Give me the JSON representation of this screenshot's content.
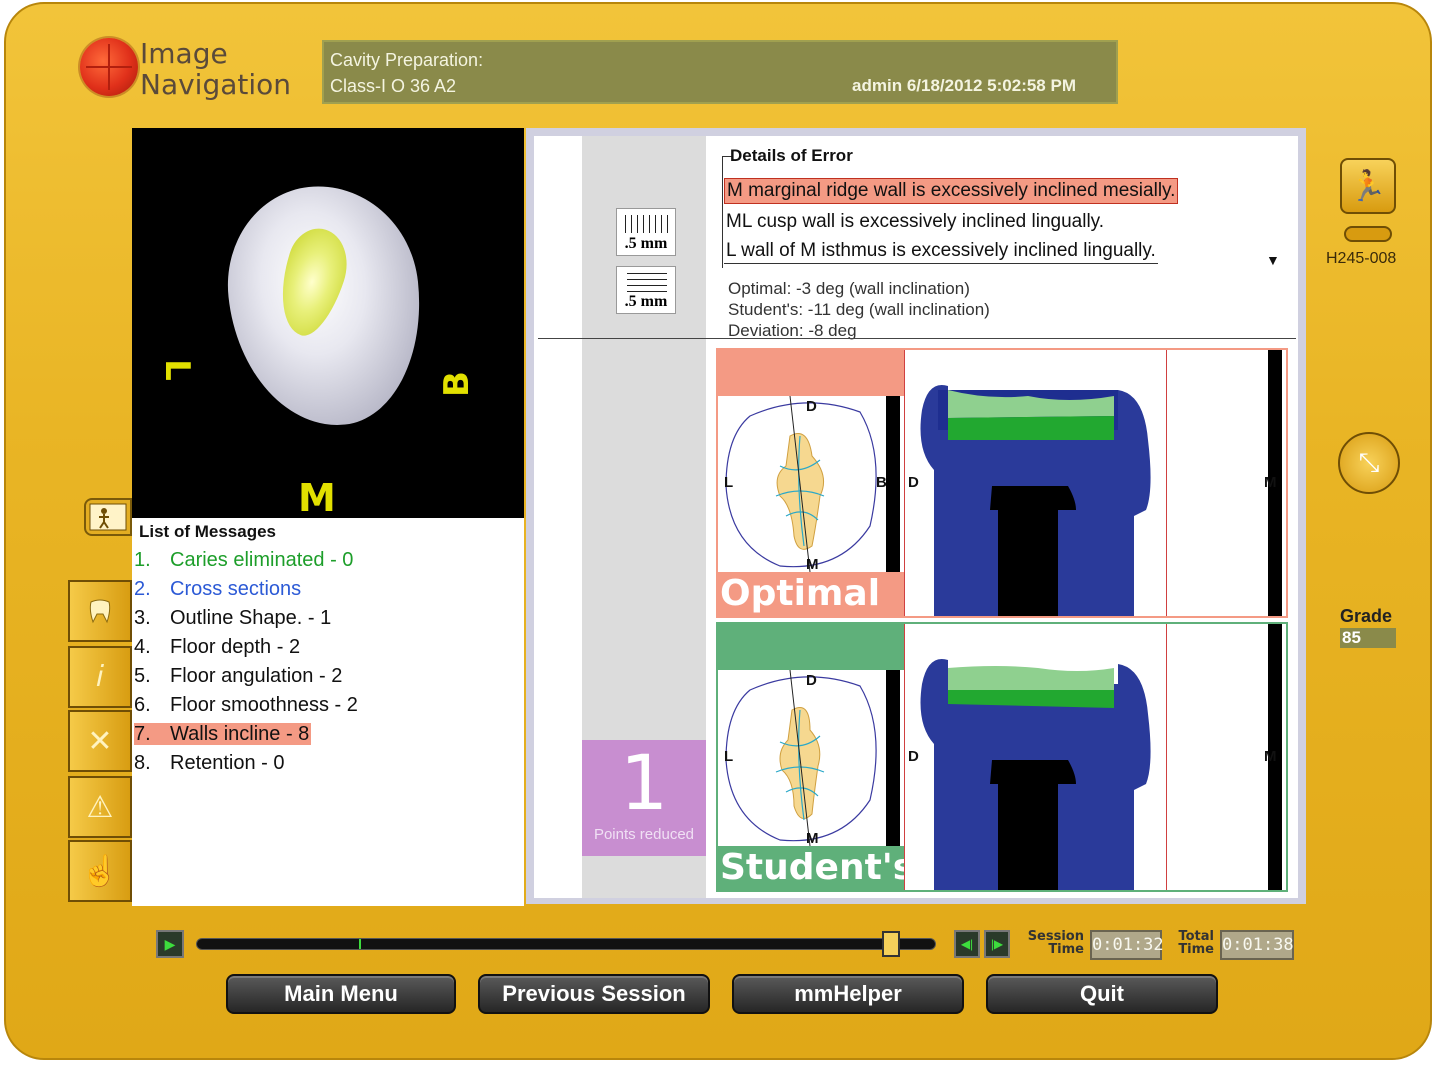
{
  "header": {
    "logo_line1": "Image",
    "logo_line2": "Navigation",
    "title1": "Cavity Preparation:",
    "title2": "Class-I O 36 A2",
    "user_datetime": "admin 6/18/2012 5:02:58 PM"
  },
  "viewer": {
    "label_left": "L",
    "label_right": "B",
    "label_bottom": "M"
  },
  "messages": {
    "title": "List of Messages",
    "items": [
      {
        "num": "1.",
        "text": "Caries eliminated - 0"
      },
      {
        "num": "2.",
        "text": "Cross sections"
      },
      {
        "num": "3.",
        "text": "Outline Shape. - 1"
      },
      {
        "num": "4.",
        "text": "Floor depth  - 2"
      },
      {
        "num": "5.",
        "text": "Floor angulation  - 2"
      },
      {
        "num": "6.",
        "text": "Floor smoothness - 2"
      },
      {
        "num": "7.",
        "text": "Walls incline - 8"
      },
      {
        "num": "8.",
        "text": "Retention - 0"
      }
    ]
  },
  "scales": {
    "scale1": ".5 mm",
    "scale2": ".5 mm"
  },
  "points": {
    "value": "1",
    "label": "Points reduced"
  },
  "details": {
    "title": "Details of Error",
    "errors": [
      "M marginal ridge wall is excessively inclined mesially.",
      "ML cusp wall is excessively inclined lingually.",
      "L wall of M isthmus is excessively inclined lingually."
    ],
    "optimal": "Optimal:   -3 deg (wall inclination)",
    "students": "Student's: -11 deg (wall inclination)",
    "deviation": "Deviation: -8 deg"
  },
  "diagrams": {
    "optimal_label": "Optimal",
    "student_label": "Student's",
    "top_D": "D",
    "top_M": "M",
    "top_L": "L",
    "top_B": "B",
    "side_D": "D",
    "side_M": "M"
  },
  "controls": {
    "session_label1": "Session",
    "session_label2": "Time",
    "session_time": "0:01:32",
    "total_label1": "Total",
    "total_label2": "Time",
    "total_time": "0:01:38",
    "timeline_progress": 0.94,
    "timeline_marker": 0.22
  },
  "buttons": {
    "main_menu": "Main Menu",
    "previous_session": "Previous Session",
    "mmhelper": "mmHelper",
    "quit": "Quit"
  },
  "sidebar": {
    "id_code": "H245-008",
    "grade_label": "Grade",
    "grade_value": "85"
  },
  "colors": {
    "frame": "#e9b525",
    "highlight": "#f49a84",
    "student_green": "#5fb07a",
    "header_olive": "#8a8a4a"
  },
  "icons": [
    "run-icon",
    "key-icon",
    "rotate-icon",
    "tooth-icon",
    "info-icon",
    "close-icon",
    "warning-icon",
    "hand-icon",
    "play-icon",
    "step-back-icon",
    "step-forward-icon"
  ]
}
